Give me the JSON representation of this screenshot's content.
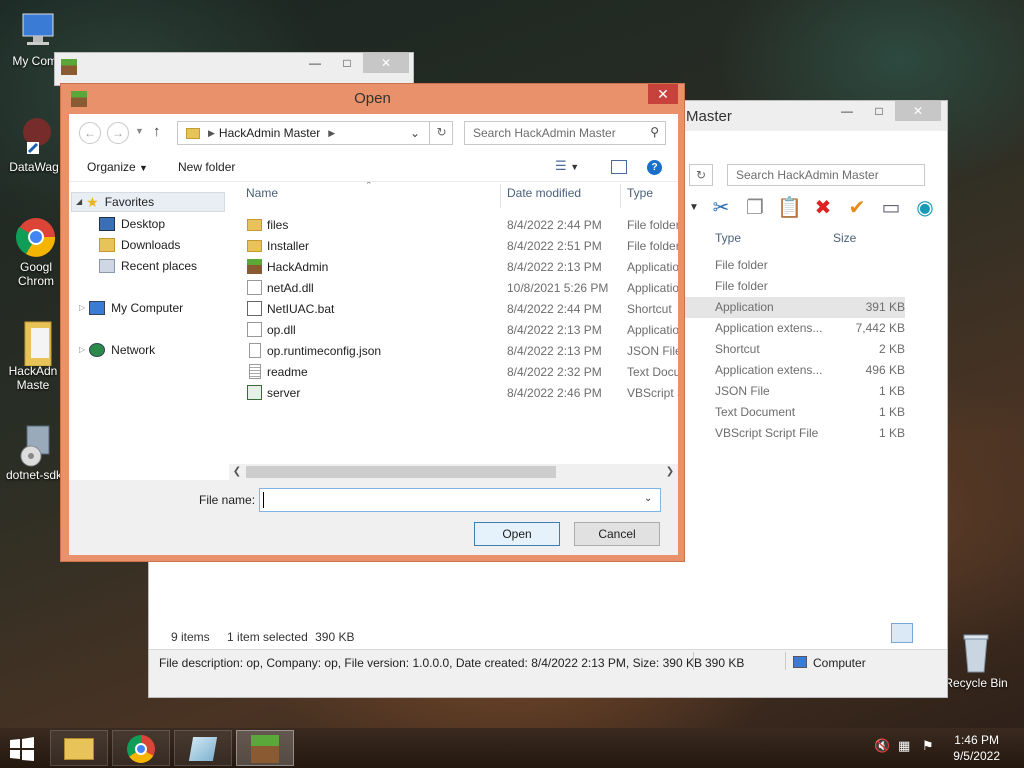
{
  "desktop": {
    "icons": [
      {
        "label": "My Comp"
      },
      {
        "label": "DataWag"
      },
      {
        "label": "Googl Chrom"
      },
      {
        "label": "HackAdn Maste"
      },
      {
        "label": "dotnet-sdk"
      },
      {
        "label": "Recycle Bin"
      }
    ]
  },
  "background_window": {
    "title": "Master",
    "search_placeholder": "Search HackAdmin Master",
    "columns": {
      "type": "Type",
      "size": "Size"
    },
    "rows": [
      {
        "type": "File folder",
        "size": ""
      },
      {
        "type": "File folder",
        "size": ""
      },
      {
        "type": "Application",
        "size": "391 KB"
      },
      {
        "type": "Application extens...",
        "size": "7,442 KB"
      },
      {
        "type": "Shortcut",
        "size": "2 KB"
      },
      {
        "type": "Application extens...",
        "size": "496 KB"
      },
      {
        "type": "JSON File",
        "size": "1 KB"
      },
      {
        "type": "Text Document",
        "size": "1 KB"
      },
      {
        "type": "VBScript Script File",
        "size": "1 KB"
      }
    ],
    "status": {
      "items": "9 items",
      "selected": "1 item selected",
      "selected_size": "390 KB"
    },
    "details": {
      "description": "File description: op, Company: op, File version: 1.0.0.0, Date created: 8/4/2022 2:13 PM, Size: 390 KB",
      "size": "390 KB",
      "location": "Computer"
    }
  },
  "dialog": {
    "title": "Open",
    "breadcrumb": "HackAdmin Master",
    "search_placeholder": "Search HackAdmin Master",
    "organize_label": "Organize",
    "new_folder_label": "New folder",
    "nav": {
      "favorites": "Favorites",
      "desktop": "Desktop",
      "downloads": "Downloads",
      "recent": "Recent places",
      "computer": "My Computer",
      "network": "Network"
    },
    "columns": {
      "name": "Name",
      "date": "Date modified",
      "type": "Type"
    },
    "files": [
      {
        "name": "files",
        "date": "8/4/2022 2:44 PM",
        "type": "File folder",
        "icon": "folder-icon"
      },
      {
        "name": "Installer",
        "date": "8/4/2022 2:51 PM",
        "type": "File folder",
        "icon": "folder-icon"
      },
      {
        "name": "HackAdmin",
        "date": "8/4/2022 2:13 PM",
        "type": "Applicatio",
        "icon": "grass-block-icon"
      },
      {
        "name": "netAd.dll",
        "date": "10/8/2021 5:26 PM",
        "type": "Applicatio",
        "icon": "dll-icon"
      },
      {
        "name": "NetIUAC.bat",
        "date": "8/4/2022 2:44 PM",
        "type": "Shortcut",
        "icon": "shortcut-icon"
      },
      {
        "name": "op.dll",
        "date": "8/4/2022 2:13 PM",
        "type": "Applicatio",
        "icon": "dll-icon"
      },
      {
        "name": "op.runtimeconfig.json",
        "date": "8/4/2022 2:13 PM",
        "type": "JSON File",
        "icon": "file-icon"
      },
      {
        "name": "readme",
        "date": "8/4/2022 2:32 PM",
        "type": "Text Docu",
        "icon": "text-file-icon"
      },
      {
        "name": "server",
        "date": "8/4/2022 2:46 PM",
        "type": "VBScript S",
        "icon": "script-icon"
      }
    ],
    "file_name_label": "File name:",
    "file_name_value": "",
    "open_label": "Open",
    "cancel_label": "Cancel"
  },
  "taskbar": {
    "time": "1:46 PM",
    "date": "9/5/2022"
  },
  "colors": {
    "dialog_frame": "#e8916a",
    "close_button": "#c7423b",
    "selection": "#e5f1fb",
    "accent": "#3c7fb1"
  }
}
